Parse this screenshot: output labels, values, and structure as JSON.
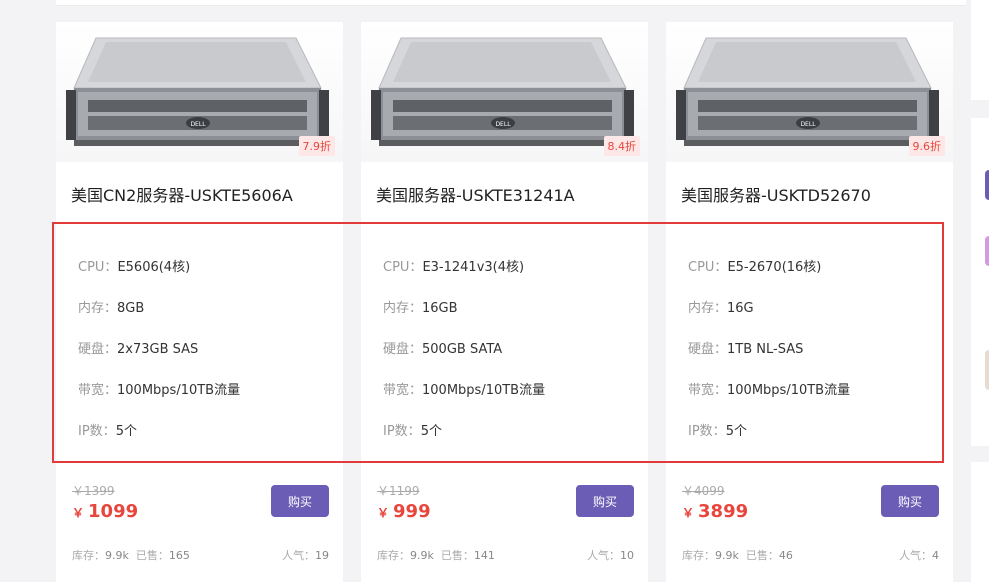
{
  "products": [
    {
      "image_alt": "Dell rack server",
      "discount": "7.9折",
      "name": "美国CN2服务器-USKTE5606A",
      "specs": [
        {
          "label": "CPU：",
          "value": "E5606(4核)"
        },
        {
          "label": "内存：",
          "value": "8GB"
        },
        {
          "label": "硬盘：",
          "value": "2x73GB SAS"
        },
        {
          "label": "带宽：",
          "value": "100Mbps/10TB流量"
        },
        {
          "label": "IP数：",
          "value": "5个"
        }
      ],
      "old_price": "￥1399",
      "currency": "￥",
      "price": "1099",
      "buy_label": "购买",
      "stock_label": "库存：",
      "stock": "9.9k",
      "sold_label": "已售：",
      "sold": "165",
      "popularity_label": "人气：",
      "popularity": "19"
    },
    {
      "image_alt": "Dell rack server",
      "discount": "8.4折",
      "name": "美国服务器-USKTE31241A",
      "specs": [
        {
          "label": "CPU：",
          "value": "E3-1241v3(4核)"
        },
        {
          "label": "内存：",
          "value": "16GB"
        },
        {
          "label": "硬盘：",
          "value": "500GB SATA"
        },
        {
          "label": "带宽：",
          "value": "100Mbps/10TB流量"
        },
        {
          "label": "IP数：",
          "value": "5个"
        }
      ],
      "old_price": "￥1199",
      "currency": "￥",
      "price": "999",
      "buy_label": "购买",
      "stock_label": "库存：",
      "stock": "9.9k",
      "sold_label": "已售：",
      "sold": "141",
      "popularity_label": "人气：",
      "popularity": "10"
    },
    {
      "image_alt": "Dell rack server",
      "discount": "9.6折",
      "name": "美国服务器-USKTD52670",
      "specs": [
        {
          "label": "CPU：",
          "value": "E5-2670(16核)"
        },
        {
          "label": "内存：",
          "value": "16G"
        },
        {
          "label": "硬盘：",
          "value": "1TB NL-SAS"
        },
        {
          "label": "带宽：",
          "value": "100Mbps/10TB流量"
        },
        {
          "label": "IP数：",
          "value": "5个"
        }
      ],
      "old_price": "￥4099",
      "currency": "￥",
      "price": "3899",
      "buy_label": "购买",
      "stock_label": "库存：",
      "stock": "9.9k",
      "sold_label": "已售：",
      "sold": "46",
      "popularity_label": "人气：",
      "popularity": "4"
    }
  ],
  "colors": {
    "accent": "#6b5cb5",
    "price": "#e8463c",
    "highlight": "#e03a3a"
  }
}
